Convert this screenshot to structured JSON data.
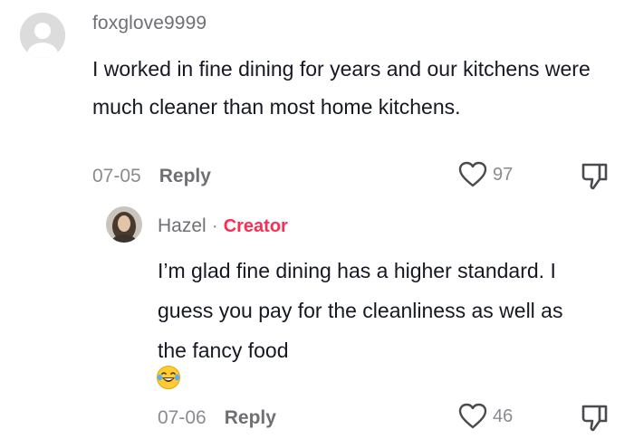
{
  "comment": {
    "username": "foxglove9999",
    "text": "I worked in fine dining for years and our kitchens were much cleaner than most home kitchens.",
    "date": "07-05",
    "reply_label": "Reply",
    "likes": "97",
    "avatar_icon": "default-user-avatar"
  },
  "reply": {
    "username": "Hazel",
    "separator": "·",
    "badge": "Creator",
    "text": "I’m glad fine dining has a higher standard. I guess you pay for the cleanliness as well as the fancy food",
    "emoji": "laughing-tears-emoji",
    "date": "07-06",
    "reply_label": "Reply",
    "likes": "46",
    "avatar_icon": "user-photo-avatar"
  },
  "colors": {
    "text": "#161823",
    "muted": "#8a8b91",
    "username": "#6f6f74",
    "creator": "#fe2c55",
    "icon": "#4a4a4f"
  }
}
